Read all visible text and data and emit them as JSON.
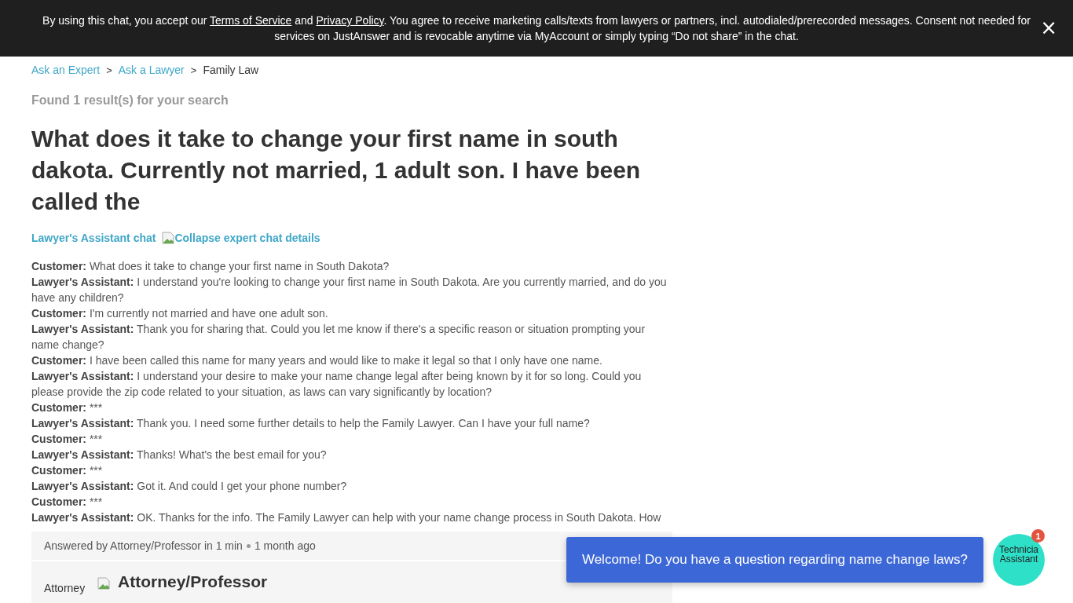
{
  "consent_banner": {
    "text_before": "By using this chat, you accept our ",
    "terms_link": "Terms of Service",
    "text_mid": " and ",
    "privacy_link": "Privacy Policy",
    "text_after": ". You agree to receive marketing calls/texts from lawyers or partners, incl. autodialed/prerecorded messages. Consent not needed for services on JustAnswer and is revocable anytime via MyAccount or simply typing “Do not share” in the chat.",
    "close": "×"
  },
  "breadcrumbs": [
    {
      "label": "Ask an Expert",
      "link": true
    },
    {
      "label": "Ask a Lawyer",
      "link": true
    },
    {
      "label": "Family Law",
      "link": false
    }
  ],
  "breadcrumb_separator": ">",
  "result_count": "Found 1 result(s) for your search",
  "question_title": "What does it take to change your first name in south dakota. Currently not married, 1 adult son. I have been called the",
  "chat_toggle": {
    "label": "Lawyer's Assistant chat",
    "collapse_link": "Collapse expert chat details"
  },
  "messages": [
    {
      "speaker": "Customer:",
      "text": "What does it take to change your first name in South Dakota?"
    },
    {
      "speaker": "Lawyer's Assistant:",
      "text": "I understand you're looking to change your first name in South Dakota. Are you currently married, and do you have any children?"
    },
    {
      "speaker": "Customer:",
      "text": "I'm currently not married and have one adult son."
    },
    {
      "speaker": "Lawyer's Assistant:",
      "text": "Thank you for sharing that. Could you let me know if there's a specific reason or situation prompting your name change?"
    },
    {
      "speaker": "Customer:",
      "text": "I have been called this name for many years and would like to make it legal so that I only have one name."
    },
    {
      "speaker": "Lawyer's Assistant:",
      "text": "I understand your desire to make your name change legal after being known by it for so long. Could you please provide the zip code related to your situation, as laws can vary significantly by location?"
    },
    {
      "speaker": "Customer:",
      "text": "***"
    },
    {
      "speaker": "Lawyer's Assistant:",
      "text": "Thank you. I need some further details to help the Family Lawyer. Can I have your full name?"
    },
    {
      "speaker": "Customer:",
      "text": "***"
    },
    {
      "speaker": "Lawyer's Assistant:",
      "text": "Thanks! What's the best email for you?"
    },
    {
      "speaker": "Customer:",
      "text": "***"
    },
    {
      "speaker": "Lawyer's Assistant:",
      "text": "Got it. And could I get your phone number?"
    },
    {
      "speaker": "Customer:",
      "text": "***"
    },
    {
      "speaker": "Lawyer's Assistant:",
      "text": "OK. Thanks for the info. The Family Lawyer can help with your name change process in South Dakota. How"
    }
  ],
  "answer": {
    "answered_by": "Answered by Attorney/Professor in 1 min",
    "time": "1 month ago",
    "avatar_alt": "Attorney",
    "expert_name": "Attorney/Professor"
  },
  "chat_widget": {
    "message": "Welcome! Do you have a question regarding name change laws?",
    "avatar_lines": [
      "Technicia",
      "Assistant"
    ],
    "badge": "1"
  }
}
